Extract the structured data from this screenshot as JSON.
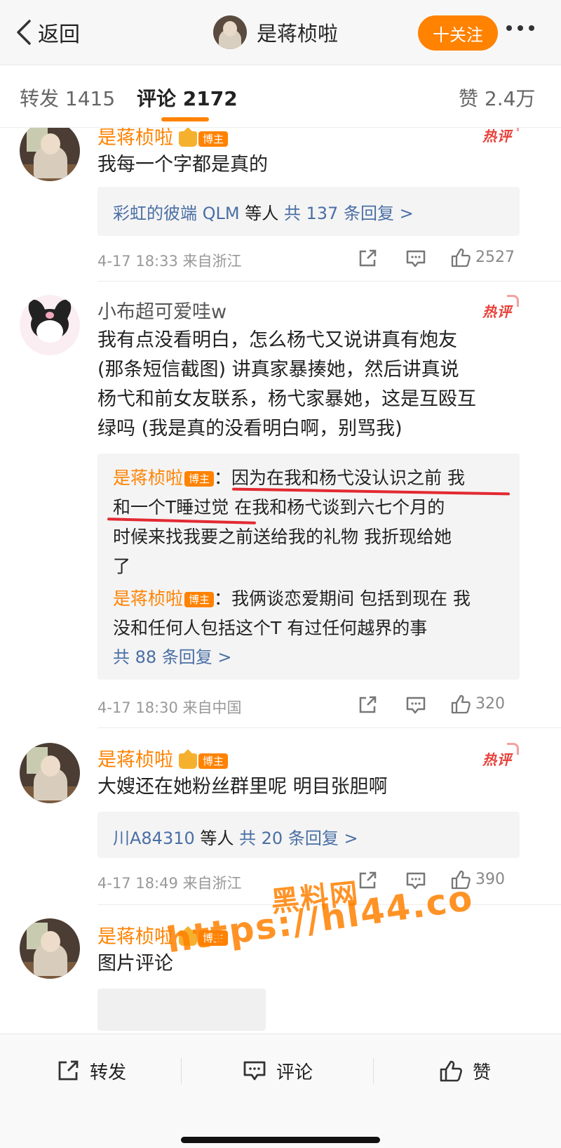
{
  "nav": {
    "back_label": "返回",
    "title": "是蒋桢啦",
    "follow_label": "十关注"
  },
  "tabs": {
    "repost": "转发 1415",
    "comment": "评论 2172",
    "like": "赞 2.4万"
  },
  "comments": [
    {
      "username": "是蒋桢啦",
      "host_badge": "博主",
      "hot_tag": "热评",
      "text": "我每一个字都是真的",
      "reply_summary_who": "彩虹的彼端 QLM",
      "reply_summary_plain": " 等人 ",
      "reply_summary_count": "共 137 条回复 >",
      "meta": "4-17 18:33  来自浙江",
      "likes": "2527"
    },
    {
      "username": "小布超可爱哇w",
      "hot_tag": "热评",
      "text_lines": [
        "我有点没看明白，怎么杨弋又说讲真有炮友",
        "(那条短信截图) 讲真家暴揍她，然后讲真说",
        "杨弋和前女友联系，杨弋家暴她，这是互殴互",
        "绿吗 (我是真的没看明白啊，别骂我)"
      ],
      "reply1_name": "是蒋桢啦",
      "reply1_badge": "博主",
      "reply1_lines": [
        "：因为在我和杨弋没认识之前 我",
        "和一个T睡过觉 在我和杨弋谈到六七个月的",
        "时候来找我要之前送给我的礼物 我折现给她",
        "了"
      ],
      "reply2_name": "是蒋桢啦",
      "reply2_badge": "博主",
      "reply2_lines": [
        "：我俩谈恋爱期间 包括到现在 我",
        "没和任何人包括这个T 有过任何越界的事"
      ],
      "reply_more": "共 88 条回复 >",
      "meta": "4-17 18:30  来自中国",
      "likes": "320"
    },
    {
      "username": "是蒋桢啦",
      "host_badge": "博主",
      "hot_tag": "热评",
      "text": "大嫂还在她粉丝群里呢 明目张胆啊",
      "reply_summary_who": "川A84310",
      "reply_summary_plain": " 等人 ",
      "reply_summary_count": "共 20 条回复 >",
      "meta": "4-17 18:49  来自浙江",
      "likes": "390"
    },
    {
      "username": "是蒋桢啦",
      "host_badge": "博主",
      "text": "图片评论"
    }
  ],
  "watermark": {
    "line1": "黑料网",
    "line2": "https://hl44.co"
  },
  "bottom": {
    "repost": "转发",
    "comment": "评论",
    "like": "赞"
  },
  "colors": {
    "accent": "#ff8200",
    "link": "#4a6fa5",
    "hot": "#e8403a",
    "annotation": "#e22a32"
  }
}
